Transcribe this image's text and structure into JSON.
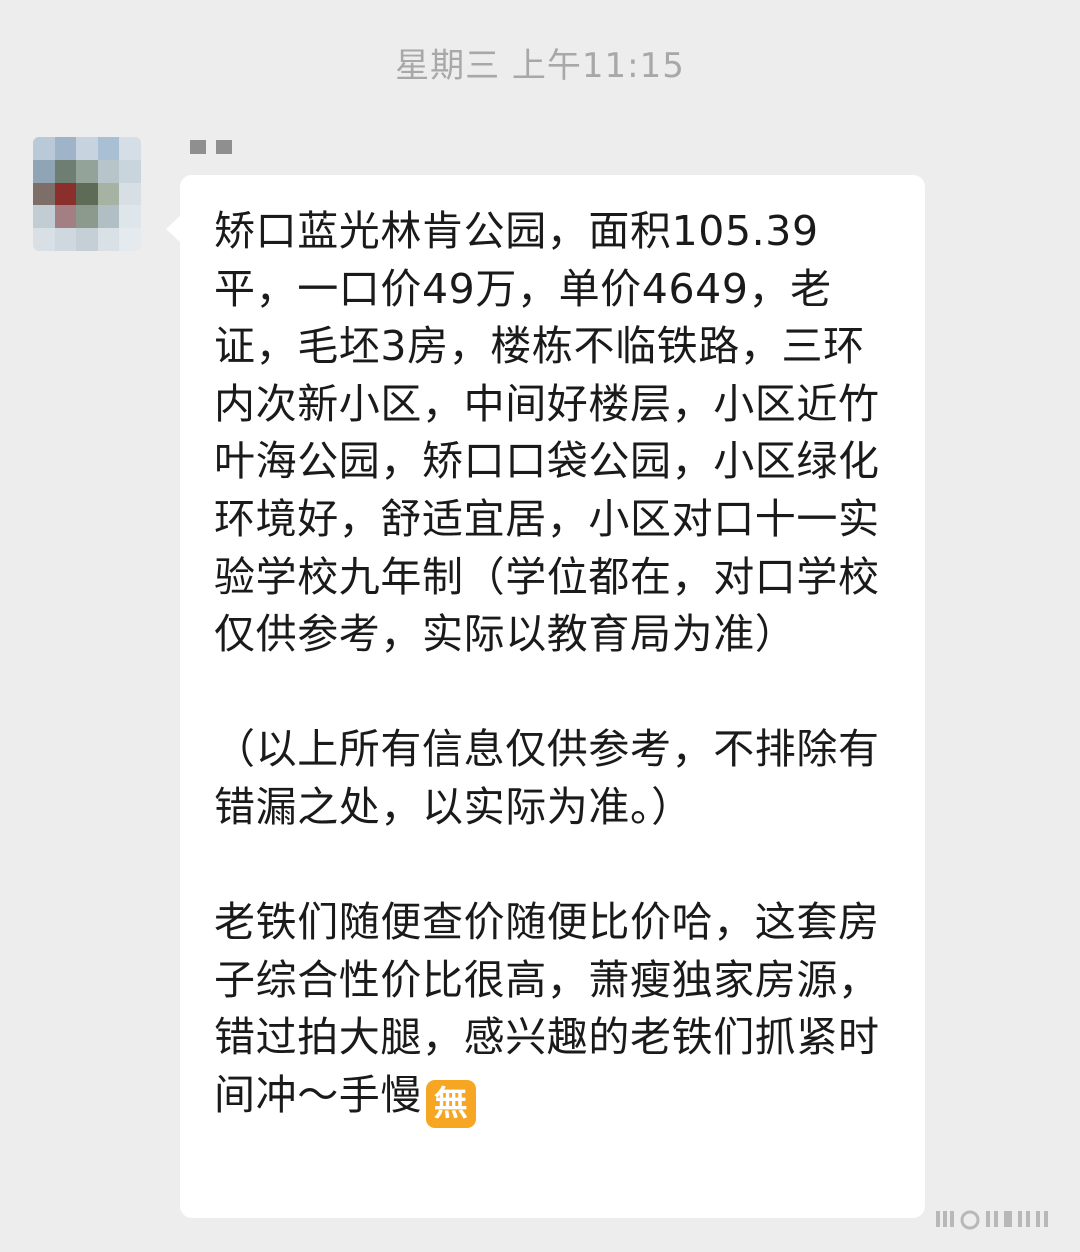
{
  "chat": {
    "timestamp": "星期三 上午11:15",
    "message": {
      "paragraph_1": "矫口蓝光林肯公园，面积105.39平，一口价49万，单价4649，老证，毛坯3房，楼栋不临铁路，三环内次新小区，中间好楼层，小区近竹叶海公园，矫口口袋公园，小区绿化环境好，舒适宜居，小区对口十一实验学校九年制（学位都在，对口学校仅供参考，实际以教育局为准）",
      "paragraph_2": "（以上所有信息仅供参考，不排除有错漏之处，以实际为准。）",
      "paragraph_3": "老铁们随便查价随便比价哈，这套房子综合性价比很高，萧瘦独家房源，错过拍大腿，感兴趣的老铁们抓紧时间冲～手慢",
      "emoji_text": "無"
    }
  },
  "colors": {
    "background": "#ededed",
    "bubble": "#ffffff",
    "timestamp_text": "#a8a8a8",
    "message_text": "#1a1a1a",
    "emoji_bg": "#f6a623"
  },
  "icons": {
    "avatar": "pixelated-avatar",
    "emoji": "wu-emoji-icon"
  }
}
